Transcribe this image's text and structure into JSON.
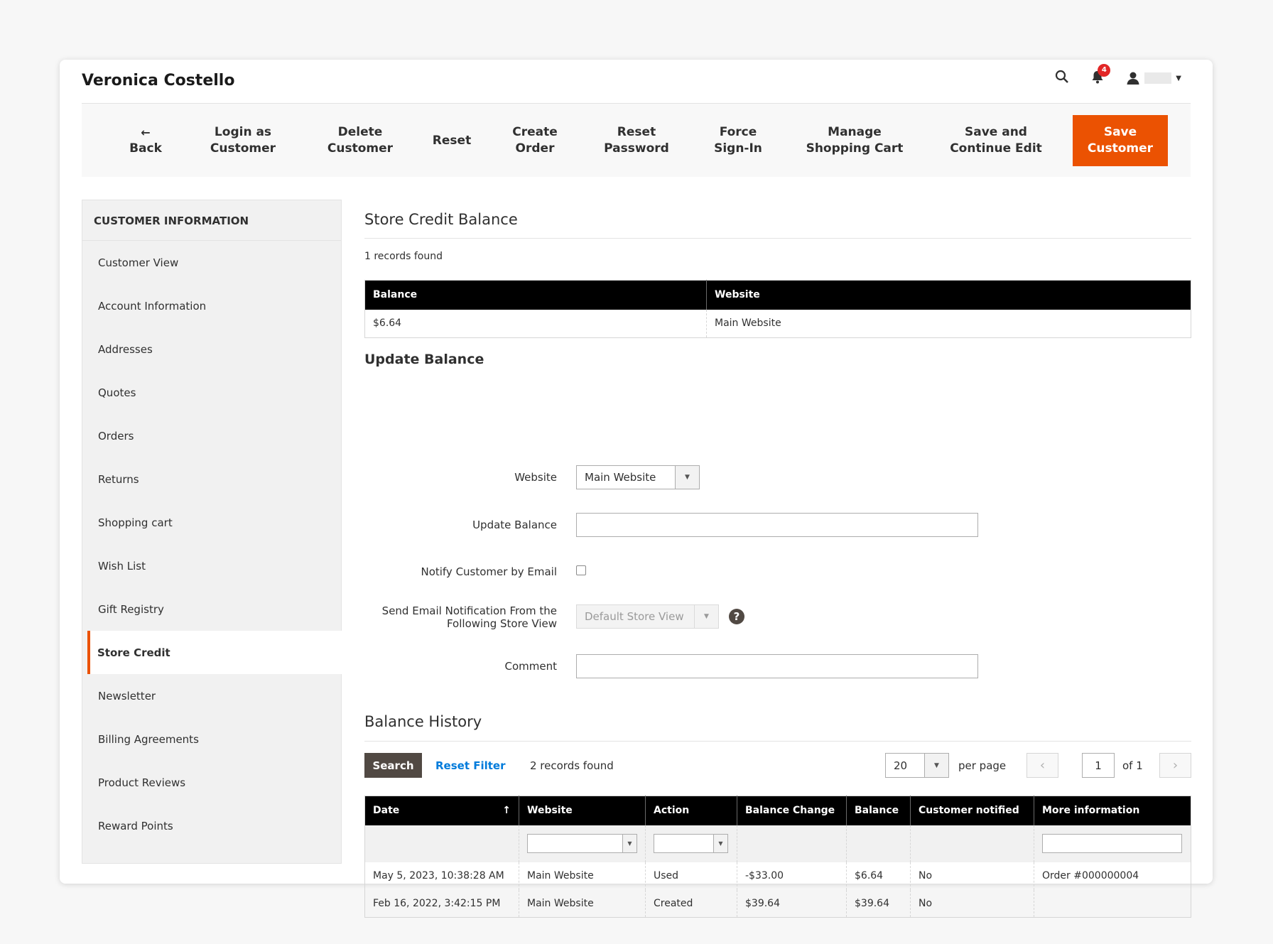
{
  "header": {
    "title": "Veronica Costello",
    "notification_count": "4"
  },
  "actions": {
    "back": "Back",
    "back_arrow": "←",
    "login_as_customer": [
      "Login as",
      "Customer"
    ],
    "delete_customer": [
      "Delete",
      "Customer"
    ],
    "reset": "Reset",
    "create_order": [
      "Create",
      "Order"
    ],
    "reset_password": [
      "Reset",
      "Password"
    ],
    "force_sign_in": [
      "Force",
      "Sign-In"
    ],
    "manage_shopping_cart": [
      "Manage",
      "Shopping Cart"
    ],
    "save_and_continue": [
      "Save and",
      "Continue Edit"
    ],
    "save_customer": [
      "Save",
      "Customer"
    ],
    "accent_color": "#eb5202"
  },
  "sidebar": {
    "heading": "CUSTOMER INFORMATION",
    "items": [
      {
        "label": "Customer View"
      },
      {
        "label": "Account Information"
      },
      {
        "label": "Addresses"
      },
      {
        "label": "Quotes"
      },
      {
        "label": "Orders"
      },
      {
        "label": "Returns"
      },
      {
        "label": "Shopping cart"
      },
      {
        "label": "Wish List"
      },
      {
        "label": "Gift Registry"
      },
      {
        "label": "Store Credit",
        "active": true
      },
      {
        "label": "Newsletter"
      },
      {
        "label": "Billing Agreements"
      },
      {
        "label": "Product Reviews"
      },
      {
        "label": "Reward Points"
      }
    ]
  },
  "store_credit": {
    "title": "Store Credit Balance",
    "records": "1 records found",
    "columns": [
      "Balance",
      "Website"
    ],
    "rows": [
      [
        "$6.64",
        "Main Website"
      ]
    ]
  },
  "update_balance": {
    "title": "Update Balance",
    "website_label": "Website",
    "website_value": "Main Website",
    "update_balance_label": "Update Balance",
    "update_balance_value": "",
    "notify_label": "Notify Customer by Email",
    "notify_checked": false,
    "store_view_label_line1": "Send Email Notification From the",
    "store_view_label_line2": "Following Store View",
    "store_view_value": "Default Store View",
    "help_glyph": "?",
    "comment_label": "Comment",
    "comment_value": ""
  },
  "balance_history": {
    "title": "Balance History",
    "search_label": "Search",
    "reset_filter_label": "Reset Filter",
    "records": "2 records found",
    "per_page_value": "20",
    "per_page_label": "per page",
    "page_value": "1",
    "page_of": "of 1",
    "prev_glyph": "‹",
    "next_glyph": "›",
    "sort_glyph": "↑",
    "columns": [
      "Date",
      "Website",
      "Action",
      "Balance Change",
      "Balance",
      "Customer notified",
      "More information"
    ],
    "rows": [
      [
        "May 5, 2023, 10:38:28 AM",
        "Main Website",
        "Used",
        "-$33.00",
        "$6.64",
        "No",
        "Order #000000004"
      ],
      [
        "Feb 16, 2022, 3:42:15 PM",
        "Main Website",
        "Created",
        "$39.64",
        "$39.64",
        "No",
        ""
      ]
    ]
  }
}
